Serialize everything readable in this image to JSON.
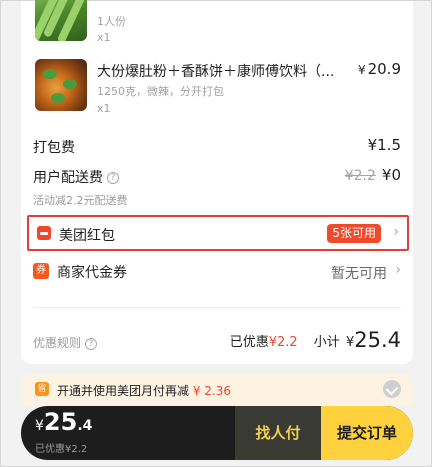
{
  "items": [
    {
      "name": "",
      "spec": "1人份",
      "qty": "x1",
      "price": ""
    },
    {
      "name": "大份爆肚粉＋香酥饼＋康师傅饮料（...",
      "spec": "1250克，微辣，分开打包",
      "qty": "x1",
      "price_currency": "¥",
      "price": "20.9"
    }
  ],
  "fees": {
    "packing_label": "打包费",
    "packing_value": "¥1.5",
    "delivery_label": "用户配送费",
    "delivery_original": "¥2.2",
    "delivery_value": "¥0",
    "delivery_note": "活动减2.2元配送费"
  },
  "red_packet": {
    "label": "美团红包",
    "badge": "5张可用"
  },
  "merchant_coupon": {
    "icon_text": "券",
    "label": "商家代金券",
    "value": "暂无可用"
  },
  "summary": {
    "rules_label": "优惠规则",
    "discount_label": "已优惠",
    "discount_value": "¥2.2",
    "subtotal_label": "小计",
    "subtotal_currency": "¥",
    "subtotal_value": "25.4"
  },
  "tip": {
    "icon_text": "省",
    "text": "开通并使用美团月付再减",
    "amount": "¥ 2.36"
  },
  "bottom": {
    "currency": "¥",
    "total_int": "25",
    "total_dec": ".4",
    "saved": "已优惠¥2.2",
    "friend_pay": "找人付",
    "submit": "提交订单"
  },
  "colors": {
    "accent_red": "#f0462e",
    "highlight_border": "#e83c3c",
    "submit_yellow": "#ffd23d",
    "bar_dark": "#1d1d1d"
  },
  "icons": [
    "help-circle-icon",
    "red-packet-icon",
    "coupon-icon",
    "chevron-right-icon",
    "save-icon",
    "check-circle-icon"
  ]
}
